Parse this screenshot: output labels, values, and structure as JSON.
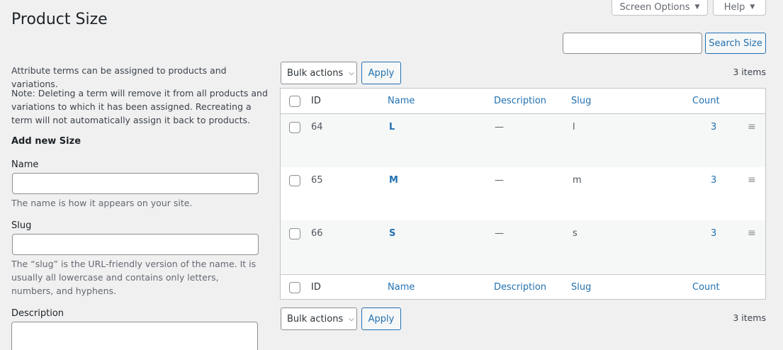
{
  "header": {
    "screen_options_label": "Screen Options",
    "help_label": "Help",
    "page_title": "Product Size"
  },
  "search": {
    "placeholder": "",
    "value": "",
    "button_label": "Search Size"
  },
  "sidebar": {
    "intro": "Attribute terms can be assigned to products and variations.",
    "note": "Note: Deleting a term will remove it from all products and variations to which it has been assigned. Recreating a term will not automatically assign it back to products.",
    "form_title": "Add new Size",
    "name_label": "Name",
    "name_value": "",
    "name_help": "The name is how it appears on your site.",
    "slug_label": "Slug",
    "slug_value": "",
    "slug_help": "The “slug” is the URL-friendly version of the name. It is usually all lowercase and contains only letters, numbers, and hyphens.",
    "description_label": "Description",
    "description_value": ""
  },
  "toolbar": {
    "bulk_actions_label": "Bulk actions",
    "apply_label": "Apply",
    "items_count": "3 items"
  },
  "table": {
    "columns": {
      "id": "ID",
      "name": "Name",
      "description": "Description",
      "slug": "Slug",
      "count": "Count"
    },
    "rows": [
      {
        "id": "64",
        "name": "L",
        "description": "—",
        "slug": "l",
        "count": "3"
      },
      {
        "id": "65",
        "name": "M",
        "description": "—",
        "slug": "m",
        "count": "3"
      },
      {
        "id": "66",
        "name": "S",
        "description": "—",
        "slug": "s",
        "count": "3"
      }
    ]
  },
  "icons": {
    "caret": "triangle-down-icon",
    "chevron": "chevron-down-icon",
    "handle": "drag-handle-icon"
  }
}
